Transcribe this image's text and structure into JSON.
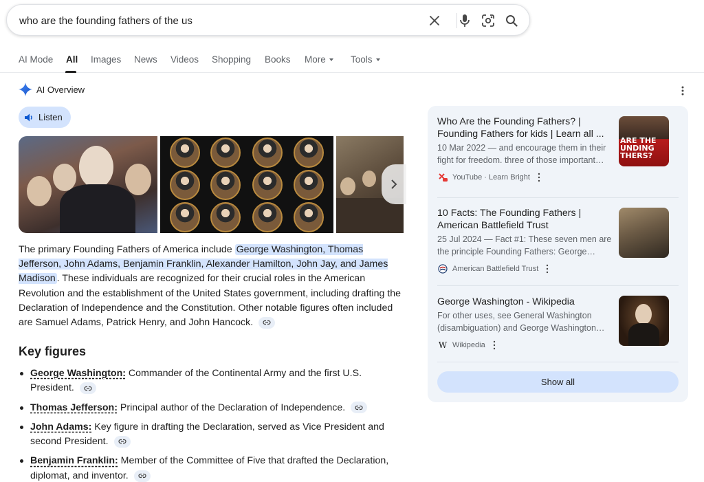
{
  "search": {
    "query": "who are the founding fathers of the us",
    "icons": [
      "close-icon",
      "microphone-icon",
      "lens-icon",
      "search-icon"
    ]
  },
  "tabs": [
    {
      "label": "AI Mode"
    },
    {
      "label": "All",
      "active": true
    },
    {
      "label": "Images"
    },
    {
      "label": "News"
    },
    {
      "label": "Videos"
    },
    {
      "label": "Shopping"
    },
    {
      "label": "Books"
    },
    {
      "label": "More"
    },
    {
      "label": "Tools"
    }
  ],
  "ai_overview": {
    "title": "AI Overview",
    "listen_label": "Listen",
    "paragraph": {
      "before": "The primary Founding Fathers of America include ",
      "highlight": "George Washington, Thomas Jefferson, John Adams, Benjamin Franklin, Alexander Hamilton, John Jay, and James Madison",
      "after": ". These individuals are recognized for their crucial roles in the American Revolution and the establishment of the United States government, including drafting the Declaration of Independence and the Constitution. Other notable figures often included are Samuel Adams, Patrick Henry, and John Hancock."
    },
    "key_figures_title": "Key figures",
    "key_figures": [
      {
        "name": "George Washington:",
        "desc": " Commander of the Continental Army and the first U.S. President."
      },
      {
        "name": "Thomas Jefferson:",
        "desc": " Principal author of the Declaration of Independence."
      },
      {
        "name": "John Adams:",
        "desc": " Key figure in drafting the Declaration, served as Vice President and second President."
      },
      {
        "name": "Benjamin Franklin:",
        "desc": " Member of the Committee of Five that drafted the Declaration, diplomat, and inventor."
      }
    ]
  },
  "sources": [
    {
      "title": "Who Are the Founding Fathers? | Founding Fathers for kids | Learn all ...",
      "snippet": "10 Mar 2022 — and encourage them in their fight for freedom. three of those important…",
      "site": "YouTube · Learn Bright",
      "thumb_text": "ARE THE UNDING THERS?"
    },
    {
      "title": "10 Facts: The Founding Fathers | American Battlefield Trust",
      "snippet": "25 Jul 2024 — Fact #1: These seven men are the principle Founding Fathers: George…",
      "site": "American Battlefield Trust"
    },
    {
      "title": "George Washington - Wikipedia",
      "snippet": "For other uses, see General Washington (disambiguation) and George Washington…",
      "site": "Wikipedia",
      "favicon_text": "W"
    }
  ],
  "show_all_label": "Show all",
  "colors": {
    "accent_blue": "#d3e3fd",
    "panel_bg": "#f0f4f9",
    "text": "#1f1f1f",
    "muted": "#5f6368"
  }
}
